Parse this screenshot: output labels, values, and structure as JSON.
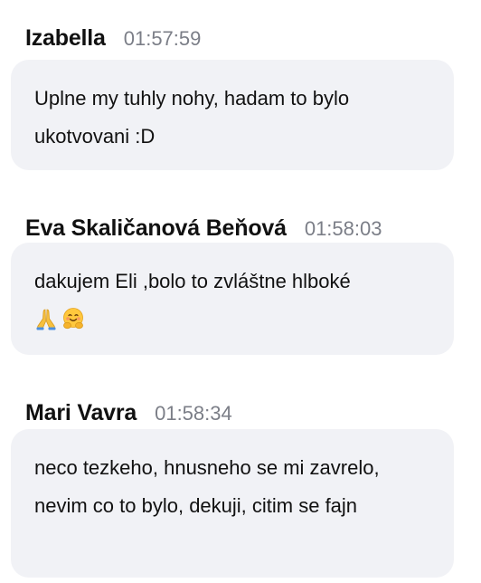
{
  "messages": [
    {
      "author": "Izabella",
      "time": "01:57:59",
      "text": "Uplne my tuhly nohy, hadam to bylo ukotvovani :D"
    },
    {
      "author": "Eva Skaličanová Beňová",
      "time": "01:58:03",
      "text": "dakujem Eli ,bolo to zvláštne hlboké",
      "emojis": [
        "folded-hands-icon",
        "hugging-face-icon"
      ]
    },
    {
      "author": "Mari Vavra",
      "time": "01:58:34",
      "text": "neco tezkeho, hnusneho se mi zavrelo, nevim co to bylo, dekuji, citim se fajn"
    }
  ],
  "colors": {
    "bubble_bg": "#f1f2f6",
    "time_text": "#7b7e87",
    "author_text": "#111111"
  }
}
